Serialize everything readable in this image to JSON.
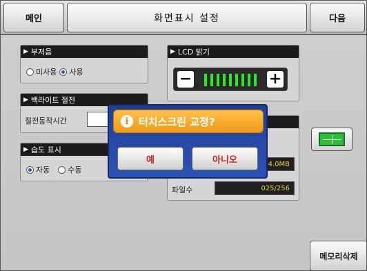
{
  "header": {
    "main_label": "메인",
    "title": "화면표시 설정",
    "next_label": "다음"
  },
  "buzzer": {
    "title": "부저음",
    "options": [
      {
        "label": "미사용",
        "selected": false
      },
      {
        "label": "사용",
        "selected": true
      }
    ]
  },
  "backlight": {
    "title": "백라이트 절전",
    "field_label": "절전동작시간",
    "value": ""
  },
  "humidity": {
    "title": "습도 표시",
    "options": [
      {
        "label": "자동",
        "selected": true
      },
      {
        "label": "수동",
        "selected": false
      }
    ]
  },
  "lcd": {
    "title": "LCD 밝기",
    "minus": "−",
    "plus": "+",
    "level_fraction": 1.0
  },
  "memory": {
    "capacity_value": "4.0MB",
    "file_count_label": "파일수",
    "file_count_value": "025/256",
    "delete_label": "메모리삭제"
  },
  "dialog": {
    "icon": "info-icon",
    "message": "터치스크린 교정?",
    "yes_label": "예",
    "no_label": "아니오"
  },
  "colors": {
    "dialog_bg": "#2d52b7",
    "prompt_bg": "#f09a14",
    "bar_green": "#2ee62e",
    "accent_blue": "#1e55c8"
  }
}
